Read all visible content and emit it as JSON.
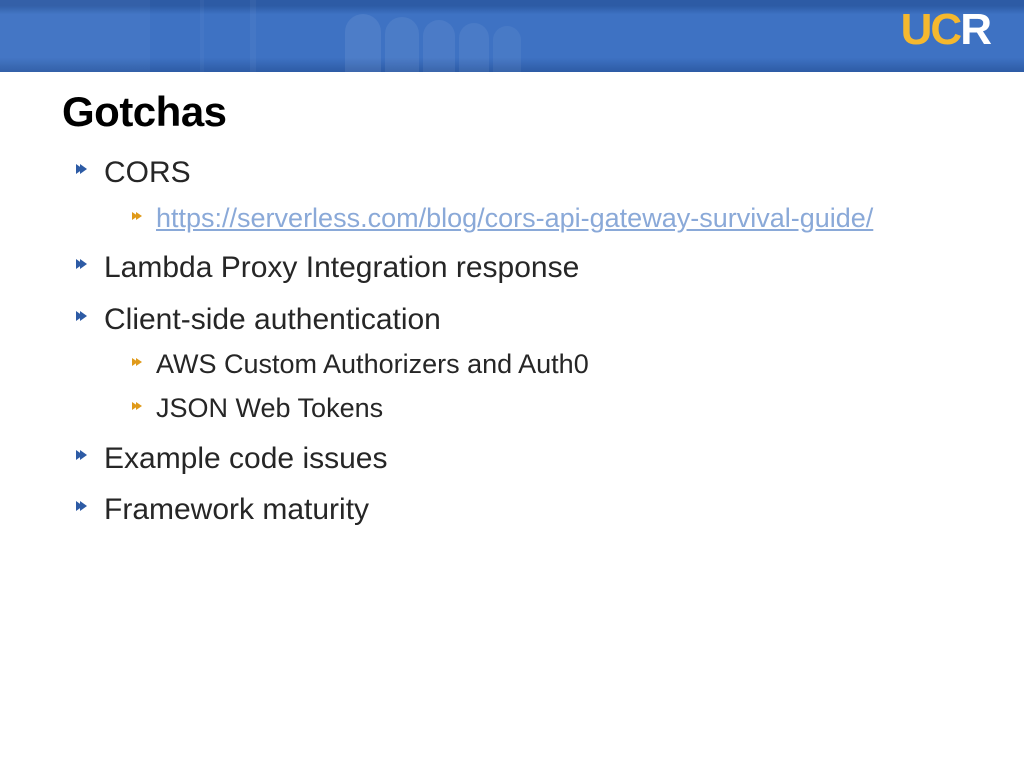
{
  "header": {
    "logo_uc": "UC",
    "logo_r": "R"
  },
  "slide": {
    "title": "Gotchas",
    "bullets": [
      {
        "text": "CORS",
        "children": [
          {
            "text": "https://serverless.com/blog/cors-api-gateway-survival-guide/",
            "link": true
          }
        ]
      },
      {
        "text": " Lambda Proxy Integration response"
      },
      {
        "text": "Client-side authentication",
        "children": [
          {
            "text": "AWS Custom Authorizers and Auth0"
          },
          {
            "text": "JSON Web Tokens"
          }
        ]
      },
      {
        "text": "Example code issues"
      },
      {
        "text": "Framework maturity"
      }
    ]
  }
}
